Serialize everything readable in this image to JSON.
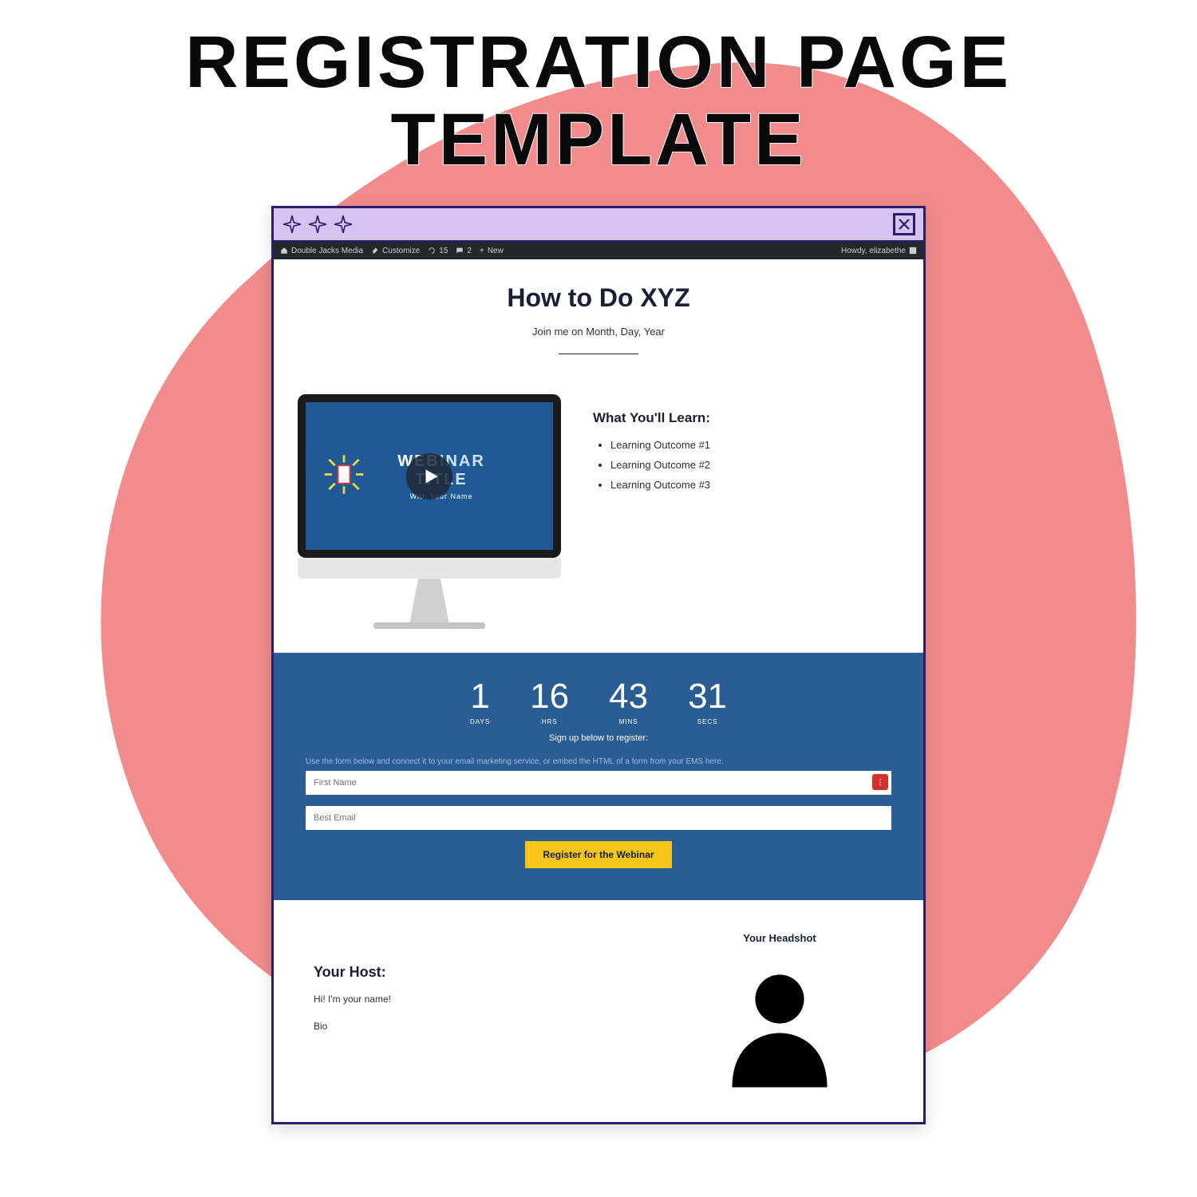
{
  "heading": {
    "line1": "REGISTRATION PAGE",
    "line2": "TEMPLATE"
  },
  "adminbar": {
    "site": "Double Jacks Media",
    "customize": "Customize",
    "updates": "15",
    "comments": "2",
    "new": "New",
    "greeting": "Howdy, elizabethe"
  },
  "hero": {
    "title": "How to Do XYZ",
    "subtitle": "Join me on Month, Day, Year"
  },
  "video": {
    "title_line1a": "WEB",
    "title_line1b": "INAR",
    "title_line2": "TITLE",
    "subtitle": "With Your Name"
  },
  "learn": {
    "heading": "What You'll Learn:",
    "items": [
      "Learning Outcome #1",
      "Learning Outcome #2",
      "Learning Outcome #3"
    ]
  },
  "countdown": {
    "days": "1",
    "days_label": "DAYS",
    "hrs": "16",
    "hrs_label": "HRS",
    "mins": "43",
    "mins_label": "MINS",
    "secs": "31",
    "secs_label": "SECS"
  },
  "form": {
    "signup_note": "Sign up below to register:",
    "helper": "Use the form below and connect it to your email marketing service, or embed the HTML of a form from your EMS here.",
    "first_name_placeholder": "First Name",
    "email_placeholder": "Best Email",
    "submit_label": "Register for the Webinar"
  },
  "host": {
    "heading": "Your Host:",
    "intro": "Hi! I'm your name!",
    "bio": "Bio",
    "headshot_caption": "Your Headshot"
  }
}
